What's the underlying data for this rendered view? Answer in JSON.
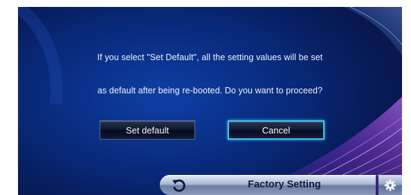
{
  "dialog": {
    "message_line_1": "If you select \"Set Default\", all the setting values will be set",
    "message_line_2": "as default after being re-booted. Do you want to proceed?"
  },
  "buttons": {
    "set_default_label": "Set default",
    "cancel_label": "Cancel"
  },
  "bottom_bar": {
    "title": "Factory Setting",
    "back_icon": "rotate-back-icon",
    "settings_icon": "gear-icon"
  },
  "colors": {
    "background": "#08297a",
    "focus_border": "#41c4ee",
    "accent_purple": "#8a2be2"
  }
}
